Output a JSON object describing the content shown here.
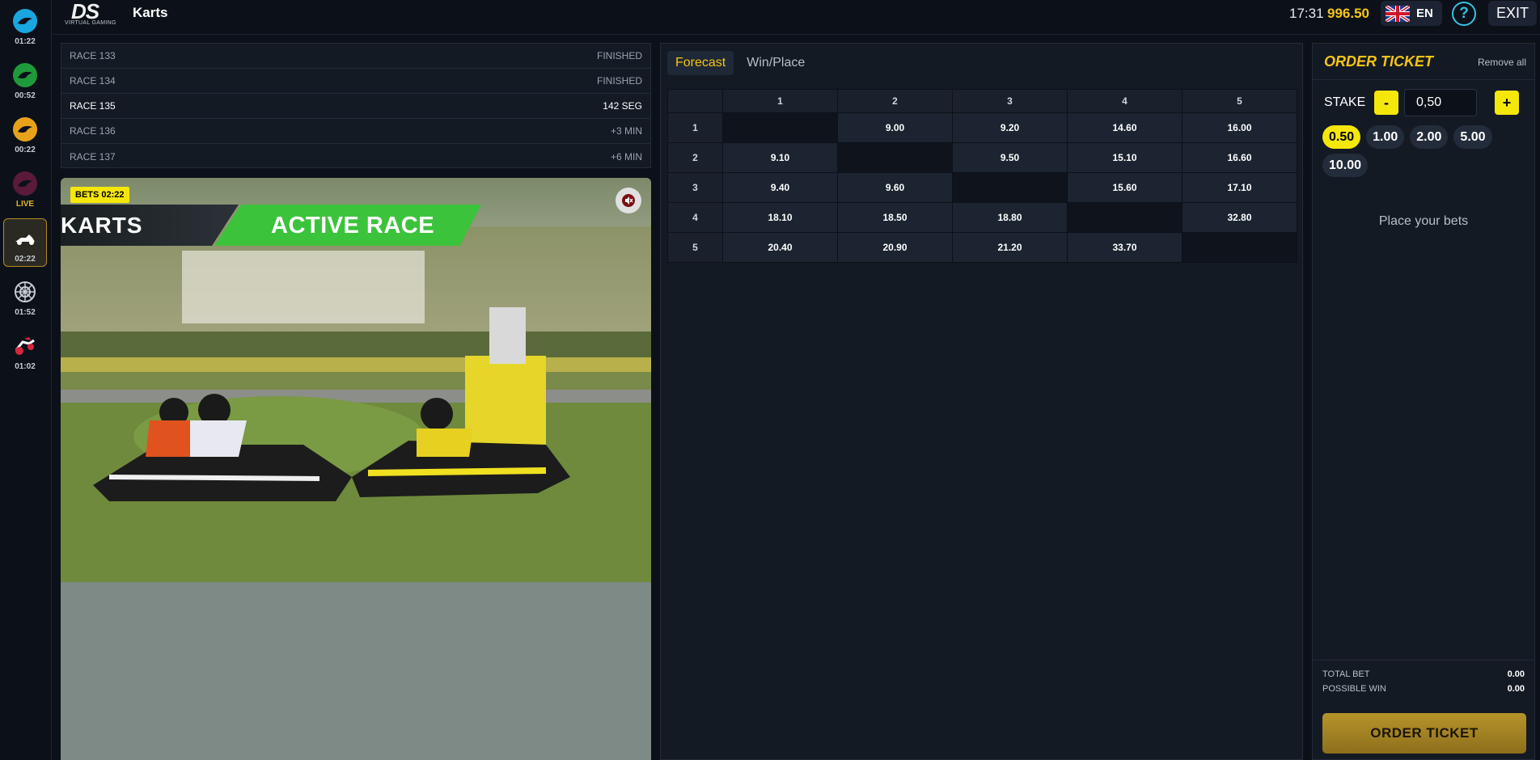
{
  "header": {
    "logo_text": "DS",
    "logo_subtext": "VIRTUAL GAMING",
    "title": "Karts",
    "clock": "17:31",
    "balance": "996.50",
    "language": "EN",
    "help_label": "?",
    "exit_label": "EXIT"
  },
  "rail": {
    "items": [
      {
        "icon": "dog-racing-blue-icon",
        "time": "01:22"
      },
      {
        "icon": "horse-racing-green-icon",
        "time": "00:52"
      },
      {
        "icon": "horse-racing-orange-icon",
        "time": "00:22"
      },
      {
        "icon": "horse-racing-live-icon",
        "time": "LIVE"
      },
      {
        "icon": "kart-icon",
        "time": "02:22"
      },
      {
        "icon": "wheel-icon",
        "time": "01:52"
      },
      {
        "icon": "motorbike-icon",
        "time": "01:02"
      }
    ]
  },
  "races": [
    {
      "name": "RACE 133",
      "status": "FINISHED"
    },
    {
      "name": "RACE 134",
      "status": "FINISHED"
    },
    {
      "name": "RACE 135",
      "status": "142 SEG"
    },
    {
      "name": "RACE 136",
      "status": "+3 MIN"
    },
    {
      "name": "RACE 137",
      "status": "+6 MIN"
    }
  ],
  "video": {
    "bets_badge": "BETS 02:22",
    "banner_left": "KARTS",
    "banner_right": "ACTIVE RACE"
  },
  "market": {
    "tabs": [
      "Forecast",
      "Win/Place"
    ],
    "columns": [
      "1",
      "2",
      "3",
      "4",
      "5"
    ],
    "rows": [
      {
        "label": "1",
        "odds": [
          "",
          "9.00",
          "9.20",
          "14.60",
          "16.00"
        ]
      },
      {
        "label": "2",
        "odds": [
          "9.10",
          "",
          "9.50",
          "15.10",
          "16.60"
        ]
      },
      {
        "label": "3",
        "odds": [
          "9.40",
          "9.60",
          "",
          "15.60",
          "17.10"
        ]
      },
      {
        "label": "4",
        "odds": [
          "18.10",
          "18.50",
          "18.80",
          "",
          "32.80"
        ]
      },
      {
        "label": "5",
        "odds": [
          "20.40",
          "20.90",
          "21.20",
          "33.70",
          ""
        ]
      }
    ]
  },
  "ticket": {
    "title": "ORDER TICKET",
    "remove_all": "Remove all",
    "stake_label": "STAKE",
    "minus": "-",
    "plus": "+",
    "stake_value": "0,50",
    "chips": [
      "0.50",
      "1.00",
      "2.00",
      "5.00",
      "10.00"
    ],
    "empty_message": "Place your bets",
    "total_bet_label": "TOTAL BET",
    "total_bet_value": "0.00",
    "possible_win_label": "POSSIBLE WIN",
    "possible_win_value": "0.00",
    "order_button": "ORDER TICKET"
  },
  "colors": {
    "accent_yellow": "#f5e70a",
    "balance_gold": "#f5c518",
    "banner_green": "#3cc33c",
    "background": "#0c1119"
  }
}
